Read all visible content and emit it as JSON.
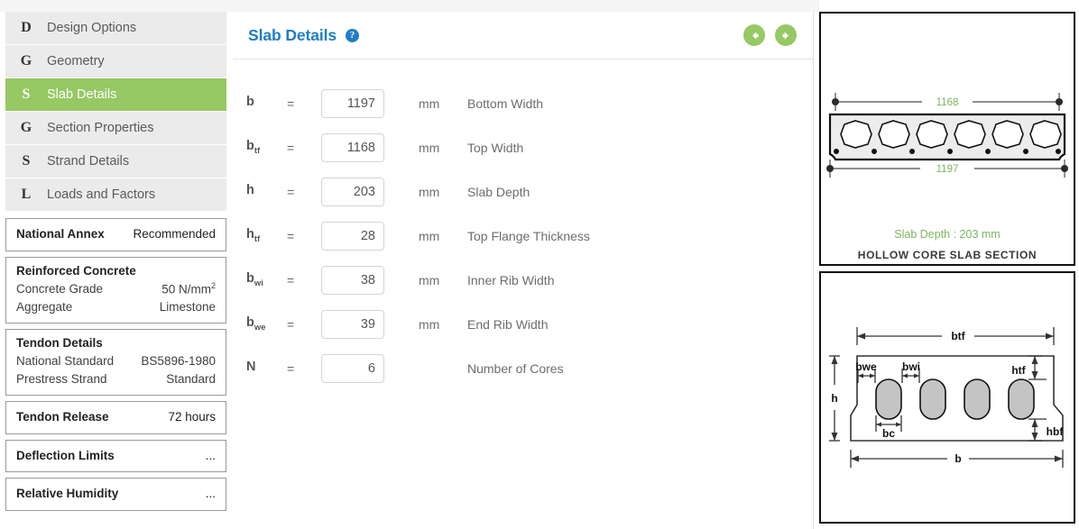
{
  "sidebar": {
    "nav_items": [
      {
        "letter": "D",
        "label": "Design Options",
        "active": false
      },
      {
        "letter": "G",
        "label": "Geometry",
        "active": false
      },
      {
        "letter": "S",
        "label": "Slab Details",
        "active": true
      },
      {
        "letter": "G",
        "label": "Section Properties",
        "active": false
      },
      {
        "letter": "S",
        "label": "Strand Details",
        "active": false
      },
      {
        "letter": "L",
        "label": "Loads and Factors",
        "active": false
      }
    ],
    "cards": {
      "national_annex": {
        "key": "National Annex",
        "value": "Recommended"
      },
      "reinforced_concrete": {
        "title": "Reinforced Concrete",
        "rows": [
          {
            "key": "Concrete Grade",
            "value": "50 N/mm",
            "sup": "2"
          },
          {
            "key": "Aggregate",
            "value": "Limestone",
            "sup": ""
          }
        ]
      },
      "tendon_details": {
        "title": "Tendon Details",
        "rows": [
          {
            "key": "National Standard",
            "value": "BS5896-1980"
          },
          {
            "key": "Prestress Strand",
            "value": "Standard"
          }
        ]
      },
      "tendon_release": {
        "key": "Tendon Release",
        "value": "72 hours"
      },
      "deflection_limits": {
        "key": "Deflection Limits",
        "value": "..."
      },
      "relative_humidity": {
        "key": "Relative Humidity",
        "value": "..."
      }
    }
  },
  "main": {
    "title": "Slab Details",
    "help_icon": "question-mark-icon",
    "prev_label": "previous-arrow-icon",
    "next_label": "next-arrow-icon",
    "fields": [
      {
        "sym": "b",
        "sub": "",
        "eq": "=",
        "value": "1197",
        "unit": "mm",
        "desc": "Bottom Width"
      },
      {
        "sym": "b",
        "sub": "tf",
        "eq": "=",
        "value": "1168",
        "unit": "mm",
        "desc": "Top Width"
      },
      {
        "sym": "h",
        "sub": "",
        "eq": "=",
        "value": "203",
        "unit": "mm",
        "desc": "Slab Depth"
      },
      {
        "sym": "h",
        "sub": "tf",
        "eq": "=",
        "value": "28",
        "unit": "mm",
        "desc": "Top Flange Thickness"
      },
      {
        "sym": "b",
        "sub": "wi",
        "eq": "=",
        "value": "38",
        "unit": "mm",
        "desc": "Inner Rib Width"
      },
      {
        "sym": "b",
        "sub": "we",
        "eq": "=",
        "value": "39",
        "unit": "mm",
        "desc": "End Rib Width"
      },
      {
        "sym": "N",
        "sub": "",
        "eq": "=",
        "value": "6",
        "unit": "",
        "desc": "Number of Cores"
      }
    ]
  },
  "diagrams": {
    "section": {
      "top_dim": "1168",
      "bottom_dim": "1197",
      "depth_note": "Slab Depth : 203 mm",
      "caption": "HOLLOW CORE SLAB SECTION",
      "core_count": 6,
      "strand_count": 7
    },
    "dimension_key": {
      "labels": [
        "btf",
        "bwe",
        "bwi",
        "htf",
        "h",
        "bc",
        "hbf",
        "b"
      ],
      "core_count": 4
    }
  },
  "colors": {
    "accent_green": "#96c864",
    "dim_green": "#7bb661",
    "title_blue": "#1f7dc4",
    "nav_bg": "#ebebeb"
  }
}
